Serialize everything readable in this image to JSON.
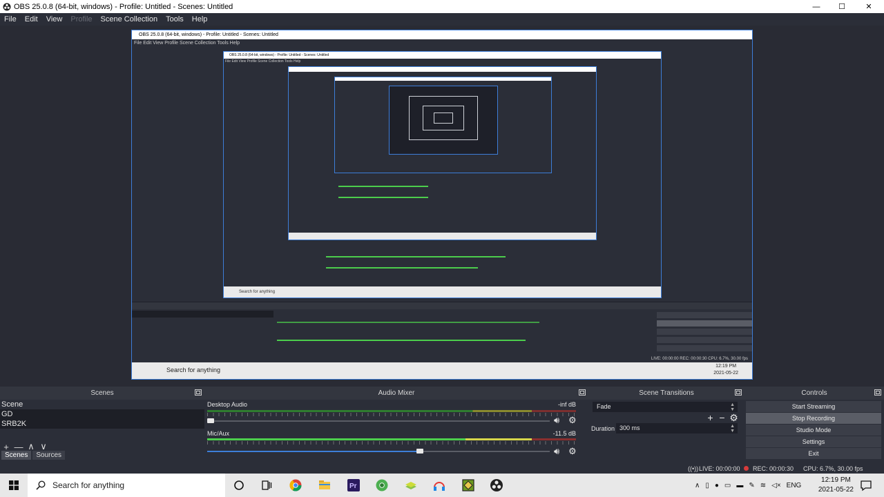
{
  "window": {
    "title": "OBS 25.0.8 (64-bit, windows) - Profile: Untitled - Scenes: Untitled",
    "controls": {
      "minimize": "—",
      "maximize": "☐",
      "close": "✕"
    }
  },
  "menu": {
    "items": [
      "File",
      "Edit",
      "View",
      "Profile",
      "Scene Collection",
      "Tools",
      "Help"
    ],
    "disabled": [
      "Profile"
    ]
  },
  "preview": {
    "nested_title": "OBS 25.0.8 (64-bit, windows) - Profile: Untitled - Scenes: Untitled",
    "nested_menu": "File  Edit  View  Profile  Scene Collection  Tools  Help",
    "nested_search": "Search for anything",
    "nested_clock_time": "12:19 PM",
    "nested_clock_date": "2021-05-22",
    "nested_status": "LIVE: 00:00:00   REC: 00:00:30   CPU: 6.7%, 30.00 fps"
  },
  "scenes": {
    "header": "Scenes",
    "items": [
      "Scene",
      "GD",
      "SRB2K"
    ],
    "toolbar": {
      "add": "+",
      "remove": "—",
      "up": "∧",
      "down": "∨"
    },
    "tabs": [
      "Scenes",
      "Sources"
    ]
  },
  "mixer": {
    "header": "Audio Mixer",
    "tracks": [
      {
        "name": "Desktop Audio",
        "db": "-inf dB",
        "volume": 0.01
      },
      {
        "name": "Mic/Aux",
        "db": "-11.5 dB",
        "volume": 0.62
      }
    ]
  },
  "transitions": {
    "header": "Scene Transitions",
    "type": "Fade",
    "duration_label": "Duration",
    "duration": "300 ms"
  },
  "controls": {
    "header": "Controls",
    "buttons": [
      "Start Streaming",
      "Stop Recording",
      "Studio Mode",
      "Settings",
      "Exit"
    ],
    "active": "Stop Recording"
  },
  "status": {
    "live": "LIVE: 00:00:00",
    "rec": "REC: 00:00:30",
    "cpu": "CPU: 6.7%, 30.00 fps",
    "rec_color": "#d83b3b"
  },
  "taskbar": {
    "search_placeholder": "Search for anything",
    "apps": [
      "cortana-icon",
      "task-view-icon",
      "chrome-icon",
      "file-explorer-icon",
      "premiere-icon",
      "chrome-canary-icon",
      "stack-icon",
      "headphones-icon",
      "gd-icon",
      "obs-icon"
    ],
    "lang": "ENG",
    "time": "12:19 PM",
    "date": "2021-05-22"
  },
  "colors": {
    "accent": "#3d7ed9",
    "dock_bg": "#2b2e38",
    "meter_green": "#4cce4c",
    "meter_yellow": "#d6d64a",
    "meter_red": "#8a2f2f"
  }
}
